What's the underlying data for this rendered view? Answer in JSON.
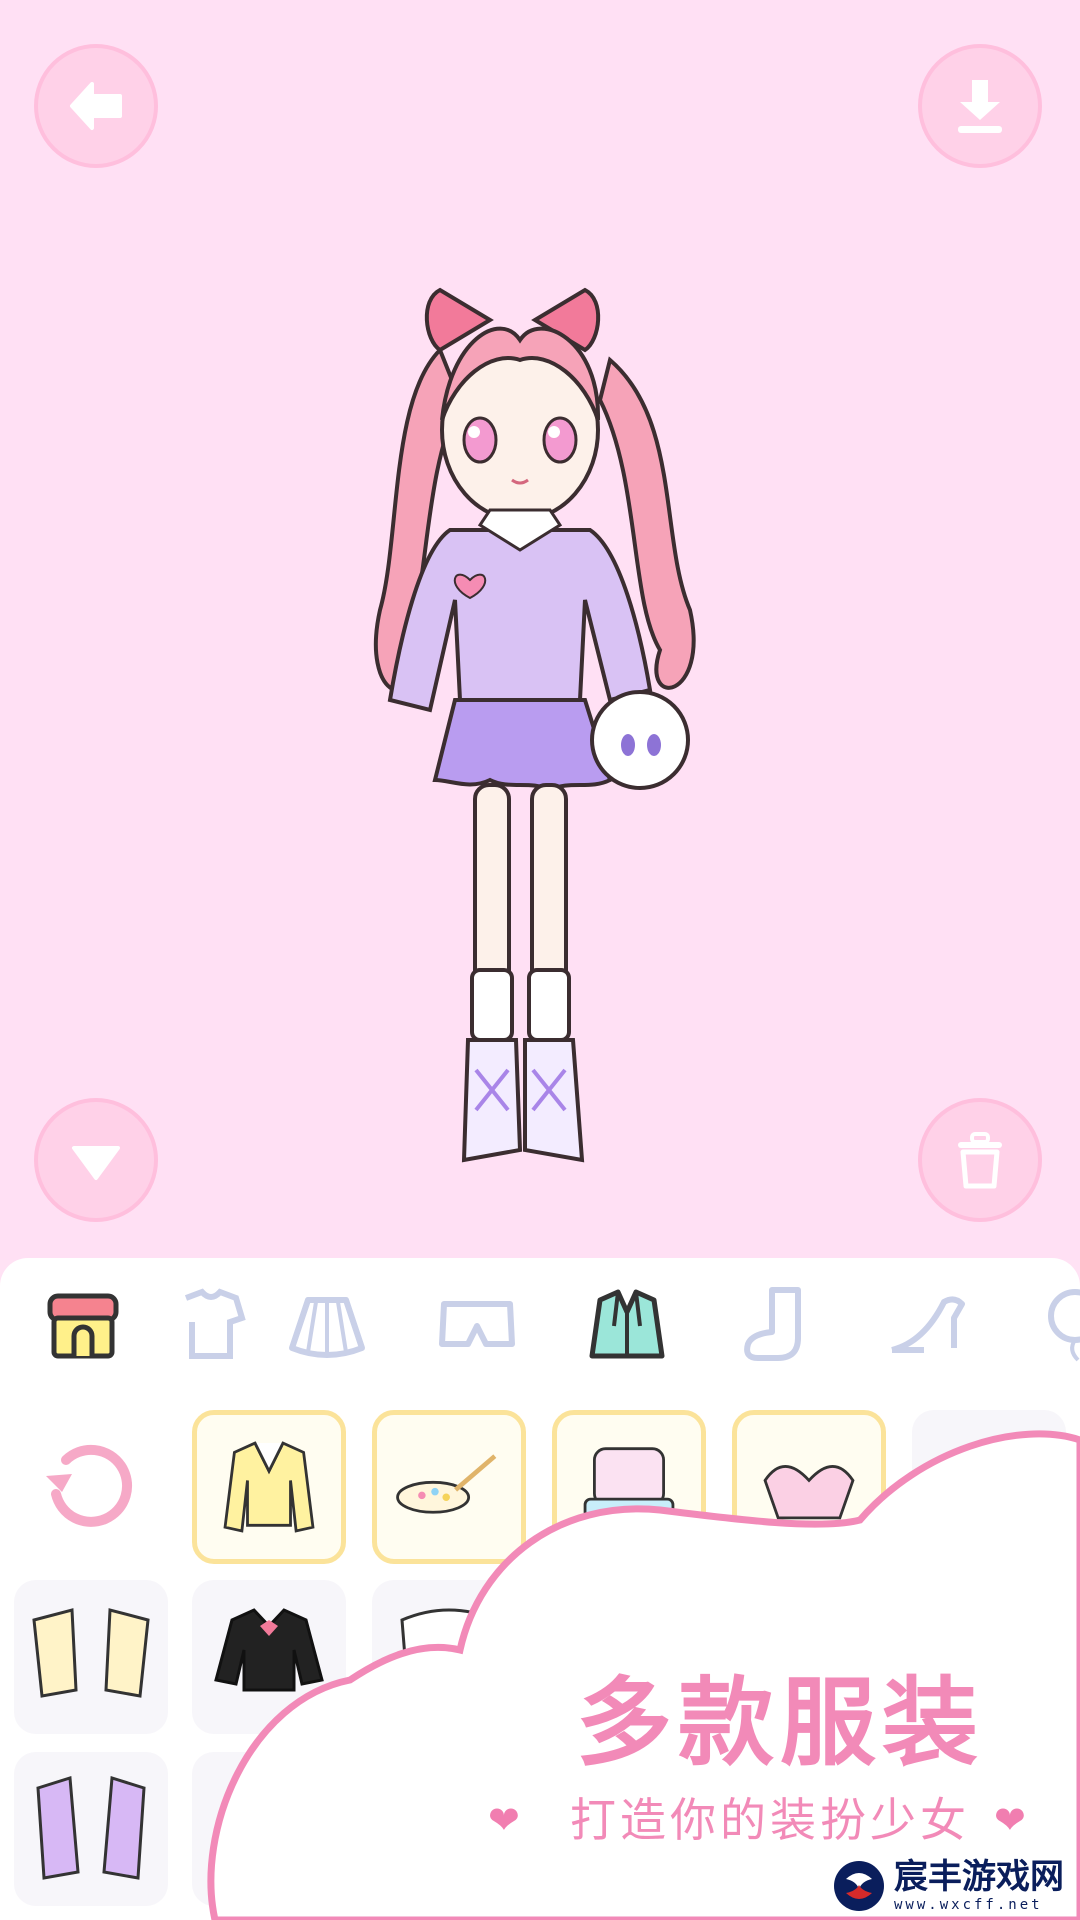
{
  "toolbar": {
    "back_icon": "arrow-left-icon",
    "download_icon": "download-icon",
    "collapse_icon": "triangle-down-icon",
    "delete_icon": "trash-icon"
  },
  "categories": [
    {
      "icon": "shop-icon",
      "selected": false
    },
    {
      "icon": "shirt-icon",
      "selected": false
    },
    {
      "icon": "skirt-icon",
      "selected": false
    },
    {
      "icon": "shorts-icon",
      "selected": false
    },
    {
      "icon": "jacket-icon",
      "selected": true
    },
    {
      "icon": "sock-icon",
      "selected": false
    },
    {
      "icon": "high-heel-icon",
      "selected": false
    },
    {
      "icon": "balloon-icon",
      "selected": false
    }
  ],
  "items": {
    "reset_icon": "reset-icon",
    "row1": [
      "yellow-cardigan",
      "palette-brush",
      "pastel-pajama-set",
      "pink-bow-set",
      "partial-item"
    ],
    "row2": [
      "cream-bolero",
      "black-sailor-top",
      "white-ruffle-top"
    ],
    "row3": [
      "purple-jacket",
      "partial-item"
    ]
  },
  "promo": {
    "title": "多款服装",
    "subtitle": "打造你的装扮少女",
    "heart": "❤"
  },
  "watermark": {
    "name": "宸丰游戏网",
    "url": "www.wxcff.net"
  },
  "colors": {
    "stage_bg": "#ffe0f4",
    "accent_pink": "#f28ab8",
    "selected_border": "#fbe39a",
    "jacket_green": "#9be6d9"
  }
}
